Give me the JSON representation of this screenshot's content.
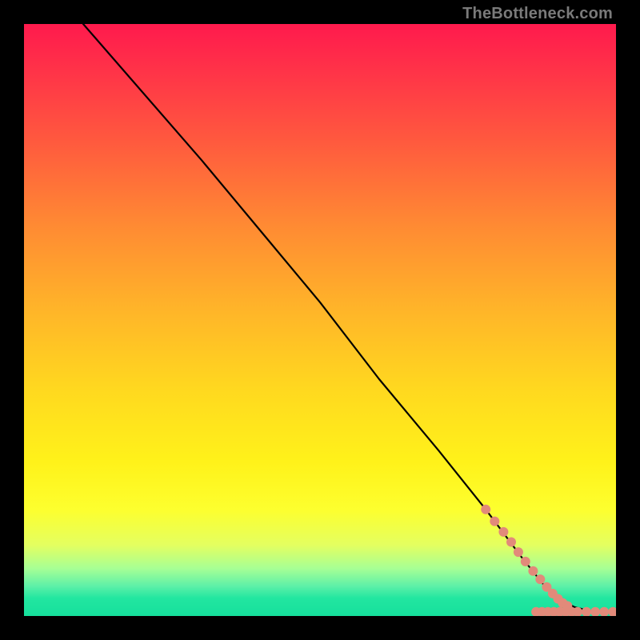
{
  "attribution": "TheBottleneck.com",
  "chart_data": {
    "type": "line",
    "title": "",
    "xlabel": "",
    "ylabel": "",
    "xlim": [
      0,
      100
    ],
    "ylim": [
      0,
      100
    ],
    "grid": false,
    "legend": false,
    "series": [
      {
        "name": "curve",
        "color": "#000000",
        "x": [
          10,
          30,
          40,
          50,
          60,
          70,
          78,
          84,
          88,
          91,
          93,
          95,
          97,
          100
        ],
        "y": [
          100,
          77,
          65,
          53,
          40,
          28,
          18,
          10,
          5,
          2.5,
          1.5,
          1,
          0.7,
          0.6
        ]
      }
    ],
    "scatter": {
      "name": "dots",
      "color": "#e28a7a",
      "radius_px": 6,
      "points": [
        {
          "x": 78,
          "y": 18
        },
        {
          "x": 79.5,
          "y": 16
        },
        {
          "x": 81,
          "y": 14.2
        },
        {
          "x": 82.3,
          "y": 12.5
        },
        {
          "x": 83.5,
          "y": 10.8
        },
        {
          "x": 84.7,
          "y": 9.2
        },
        {
          "x": 86,
          "y": 7.6
        },
        {
          "x": 87.2,
          "y": 6.2
        },
        {
          "x": 88.3,
          "y": 4.9
        },
        {
          "x": 89.3,
          "y": 3.8
        },
        {
          "x": 90.2,
          "y": 2.9
        },
        {
          "x": 91,
          "y": 2.2
        },
        {
          "x": 91.8,
          "y": 1.7
        },
        {
          "x": 86.5,
          "y": 0.7
        },
        {
          "x": 87.5,
          "y": 0.7
        },
        {
          "x": 88.5,
          "y": 0.7
        },
        {
          "x": 89.5,
          "y": 0.7
        },
        {
          "x": 90.5,
          "y": 0.7
        },
        {
          "x": 91.5,
          "y": 0.7
        },
        {
          "x": 92.5,
          "y": 0.7
        },
        {
          "x": 93.5,
          "y": 0.7
        },
        {
          "x": 95,
          "y": 0.7
        },
        {
          "x": 96.5,
          "y": 0.7
        },
        {
          "x": 98,
          "y": 0.7
        },
        {
          "x": 99.5,
          "y": 0.7
        }
      ]
    }
  }
}
